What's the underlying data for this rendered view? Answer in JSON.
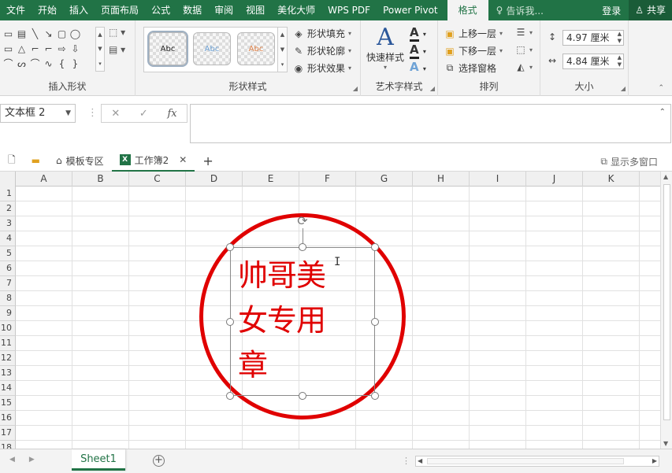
{
  "menu": {
    "tabs": [
      "文件",
      "开始",
      "插入",
      "页面布局",
      "公式",
      "数据",
      "审阅",
      "视图",
      "美化大师",
      "WPS PDF",
      "Power Pivot"
    ],
    "active_tab": "格式",
    "tell_me": "告诉我...",
    "login": "登录",
    "share": "共享"
  },
  "ribbon": {
    "insert_shapes": {
      "label": "插入形状",
      "shape_glyphs": [
        "▭",
        "▤",
        "╲",
        "↘",
        "▢",
        "◯",
        "",
        "▭",
        "△",
        "⌐",
        "⌐",
        "⇨",
        "⇩",
        "",
        "⌒",
        "ᔕ",
        "⌒",
        "∿",
        "{",
        "}",
        ""
      ]
    },
    "shape_styles": {
      "label": "形状样式",
      "sample_text": "Abc",
      "fill": "形状填充",
      "outline": "形状轮廓",
      "effects": "形状效果"
    },
    "wordart": {
      "label": "艺术字样式",
      "quick_styles": "快速样式"
    },
    "arrange": {
      "label": "排列",
      "bring_forward": "上移一层",
      "send_backward": "下移一层",
      "selection_pane": "选择窗格"
    },
    "size": {
      "label": "大小",
      "height": "4.97 厘米",
      "width": "4.84 厘米"
    }
  },
  "formula_bar": {
    "name_box": "文本框 2",
    "fx": "fx",
    "cancel": "✕",
    "enter": "✓",
    "content": ""
  },
  "workbook_tabs": {
    "template_zone": "模板专区",
    "active_book": "工作簿2",
    "show_multi_window": "显示多窗口"
  },
  "grid": {
    "columns": [
      "A",
      "B",
      "C",
      "D",
      "E",
      "F",
      "G",
      "H",
      "I",
      "J",
      "K"
    ],
    "rows": [
      "1",
      "2",
      "3",
      "4",
      "5",
      "6",
      "7",
      "8",
      "9",
      "10",
      "11",
      "12",
      "13",
      "14",
      "15",
      "16",
      "17",
      "18"
    ]
  },
  "stamp": {
    "line1": "帅哥美",
    "line2": "女专用",
    "line3": "章",
    "color": "#e00000"
  },
  "sheets": {
    "active": "Sheet1"
  },
  "colors": {
    "accent": "#217346",
    "stamp_red": "#e00000"
  }
}
